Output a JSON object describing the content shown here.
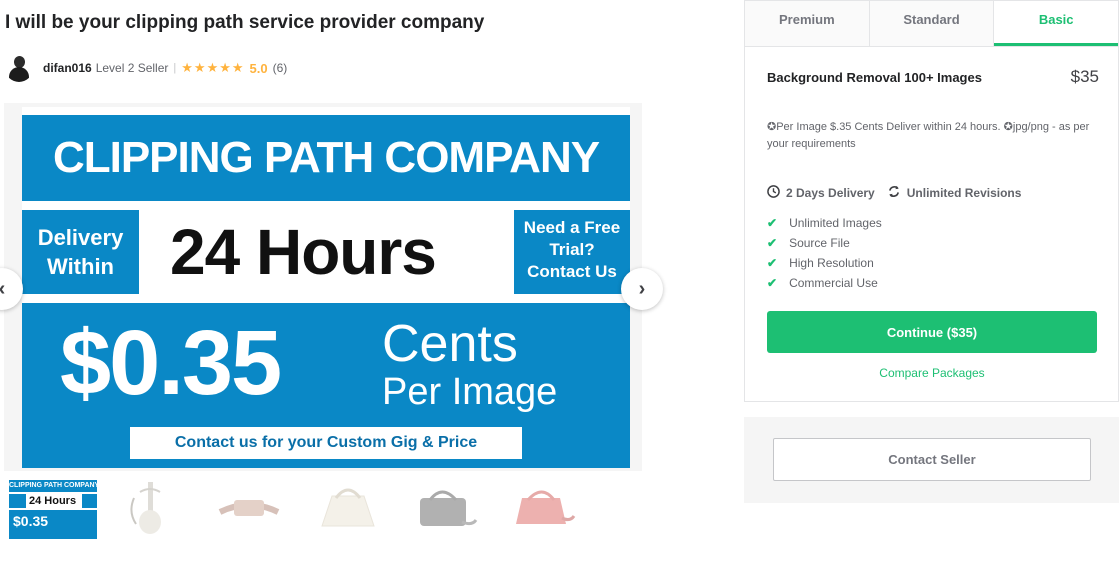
{
  "gig": {
    "title": "I will be your clipping path service provider company"
  },
  "seller": {
    "name": "difan016",
    "level": "Level 2 Seller",
    "separator": "|",
    "stars": "★★★★★",
    "rating": "5.0",
    "review_count": "(6)"
  },
  "gallery": {
    "banner": {
      "headline": "CLIPPING PATH COMPANY",
      "delivery_line1": "Delivery",
      "delivery_line2": "Within",
      "hours": "24 Hours",
      "trial_line1": "Need a Free",
      "trial_line2": "Trial?",
      "trial_line3": "Contact Us",
      "price": "$0.35",
      "cents": "Cents",
      "per_image": "Per Image",
      "contact": "Contact us for your Custom Gig & Price"
    },
    "prev_icon": "chevron-left-icon",
    "next_icon": "chevron-right-icon",
    "prev_glyph": "‹",
    "next_glyph": "›",
    "thumbnail": {
      "headline": "CLIPPING PATH COMPANY",
      "hours": "24 Hours",
      "price": "$0.35"
    }
  },
  "packages": {
    "tabs": [
      "Premium",
      "Standard",
      "Basic"
    ],
    "active_tab": "Basic",
    "name": "Background Removal 100+ Images",
    "price": "$35",
    "description": "✪Per Image $.35 Cents Deliver within 24 hours. ✪jpg/png - as per your requirements",
    "delivery": "2 Days Delivery",
    "revisions": "Unlimited Revisions",
    "features": [
      "Unlimited Images",
      "Source File",
      "High Resolution",
      "Commercial Use"
    ],
    "continue_label": "Continue ($35)",
    "compare_label": "Compare Packages"
  },
  "contact": {
    "label": "Contact Seller"
  },
  "colors": {
    "accent": "#1dbf73",
    "banner_blue": "#0a88c6",
    "star": "#ffb33e"
  }
}
